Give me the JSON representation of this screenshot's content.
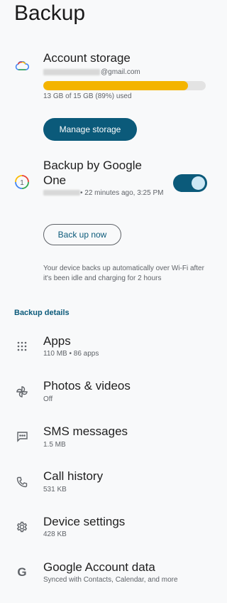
{
  "page": {
    "title": "Backup"
  },
  "storage": {
    "title": "Account storage",
    "email_suffix": "@gmail.com",
    "progress": 0.89,
    "usage_text": "13 GB of 15 GB (89%) used",
    "manage_label": "Manage storage",
    "bar_color": "#f4b400"
  },
  "backup_one": {
    "title": "Backup by Google One",
    "status_text": "• 22 minutes ago, 3:25 PM",
    "toggle_on": true,
    "button_label": "Back up now",
    "helper_text": "Your device backs up automatically over Wi-Fi after it's been idle and charging for 2 hours"
  },
  "details": {
    "section_title": "Backup details",
    "items": [
      {
        "label": "Apps",
        "sub": "110 MB • 86 apps",
        "icon": "apps-grid-icon"
      },
      {
        "label": "Photos & videos",
        "sub": "Off",
        "icon": "pinwheel-icon"
      },
      {
        "label": "SMS messages",
        "sub": "1.5 MB",
        "icon": "message-icon"
      },
      {
        "label": "Call history",
        "sub": "531 KB",
        "icon": "phone-icon"
      },
      {
        "label": "Device settings",
        "sub": "428 KB",
        "icon": "gear-icon"
      },
      {
        "label": "Google Account data",
        "sub": "Synced with Contacts, Calendar, and more",
        "icon": "google-g-icon"
      }
    ]
  },
  "colors": {
    "accent": "#0b5a7a",
    "secondary_text": "#5f6368"
  }
}
